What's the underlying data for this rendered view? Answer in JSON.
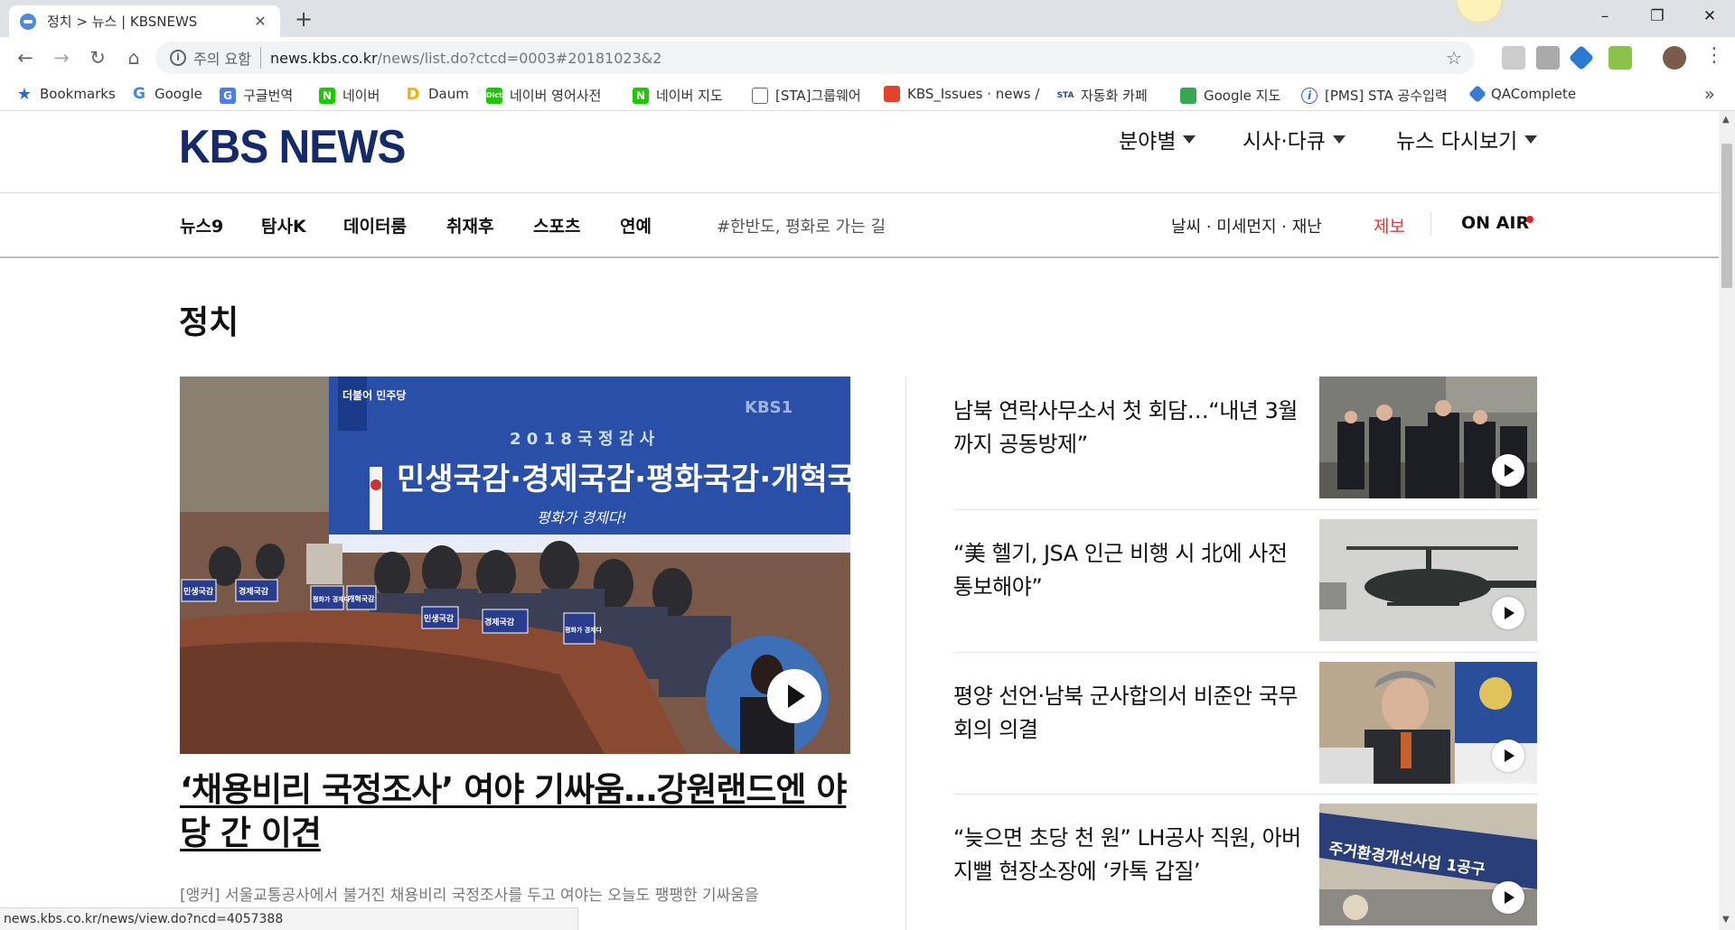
{
  "browser": {
    "tab_title": "정치 > 뉴스 | KBSNEWS",
    "tab_close": "✕",
    "new_tab": "+",
    "security_label": "주의 요함",
    "url_host": "news.kbs.co.kr",
    "url_path": "/news/list.do?ctcd=0003#20181023&2",
    "bookmarks": [
      {
        "label": "Bookmarks",
        "icon": "star-icon"
      },
      {
        "label": "Google",
        "icon": "google-icon"
      },
      {
        "label": "구글번역",
        "icon": "translate-icon"
      },
      {
        "label": "네이버",
        "icon": "naver-icon"
      },
      {
        "label": "Daum",
        "icon": "daum-icon"
      },
      {
        "label": "네이버 영어사전",
        "icon": "dict-icon"
      },
      {
        "label": "네이버 지도",
        "icon": "naver-icon"
      },
      {
        "label": "[STA]그룹웨어",
        "icon": "page-icon"
      },
      {
        "label": "KBS_Issues · news /",
        "icon": "gitlab-icon"
      },
      {
        "label": "자동화 카페",
        "icon": "sta-icon"
      },
      {
        "label": "Google 지도",
        "icon": "maps-icon"
      },
      {
        "label": "[PMS] STA 공수입력",
        "icon": "pms-icon"
      },
      {
        "label": "QAComplete",
        "icon": "qa-icon"
      }
    ],
    "bookmarks_more": "»",
    "status_url": "news.kbs.co.kr/news/view.do?ncd=4057388"
  },
  "header": {
    "logo": "KBS NEWS",
    "menus": [
      "분야별",
      "시사·다큐",
      "뉴스 다시보기"
    ]
  },
  "subnav": {
    "items": [
      "뉴스9",
      "탐사K",
      "데이터룸",
      "취재후",
      "스포츠",
      "연예"
    ],
    "hashtag": "#한반도, 평화로 가는 길",
    "utility": "날씨 · 미세먼지 · 재난",
    "tipoff": "제보",
    "onair": "ON AIR"
  },
  "section": {
    "title": "정치"
  },
  "main_story": {
    "headline": "‘채용비리 국정조사’ 여야 기싸움…강원랜드엔 야당 간 이견",
    "summary": "[앵커] 서울교통공사에서 불거진 채용비리 국정조사를 두고 여야는 오늘도 팽팽한 기싸움을",
    "image_text": {
      "banner_small": "2 0 1 8   국 정 감 사",
      "banner_big": "민생국감·경제국감·평화국감·개혁국감",
      "banner_sub": "평화가 경제다!",
      "party": "더불어 민주당",
      "watermark": "KBS1",
      "placards": [
        "민생국감",
        "경제국감",
        "평화가 경제다",
        "개혁국감",
        "민생국감",
        "경제국감",
        "평화가 경제다"
      ]
    }
  },
  "side_stories": [
    {
      "title": "남북 연락사무소서 첫 회담…“내년 3월까지 공동방제”"
    },
    {
      "title": "“美 헬기, JSA 인근 비행 시 北에 사전 통보해야”"
    },
    {
      "title": "평양 선언·남북 군사합의서 비준안 국무회의 의결"
    },
    {
      "title": "“늦으면 초당 천 원” LH공사 직원, 아버지뻘 현장소장에 ‘카톡 갑질’",
      "image_text": "주거환경개선사업 1공구"
    }
  ],
  "colors": {
    "logo": "#16296a",
    "tipoff": "#e03a3a",
    "onair_dot": "#e6202a"
  }
}
